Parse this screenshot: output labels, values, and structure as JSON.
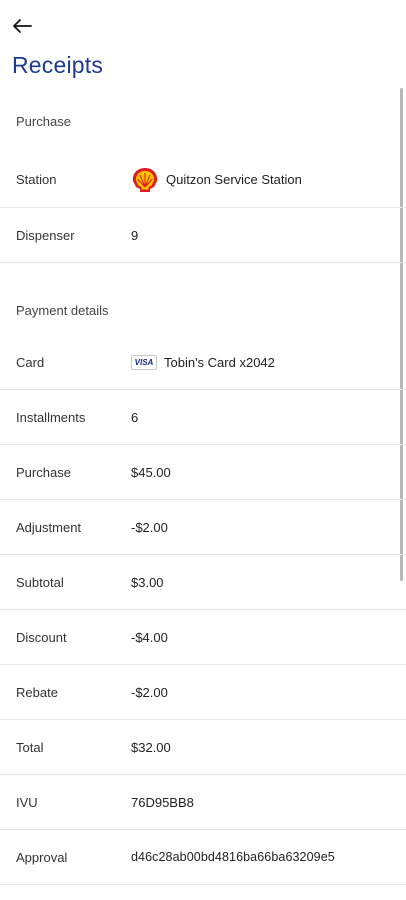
{
  "header": {
    "title": "Receipts",
    "back_icon": "arrow-left-icon"
  },
  "purchase_section": {
    "title": "Purchase",
    "station": {
      "label": "Station",
      "value": "Quitzon Service Station",
      "icon": "shell-logo-icon"
    },
    "dispenser": {
      "label": "Dispenser",
      "value": "9"
    }
  },
  "payment_section": {
    "title": "Payment details",
    "card": {
      "label": "Card",
      "value": "Tobin's Card x2042",
      "brand": "VISA"
    },
    "rows": [
      {
        "label": "Installments",
        "value": "6"
      },
      {
        "label": "Purchase",
        "value": "$45.00"
      },
      {
        "label": "Adjustment",
        "value": "-$2.00"
      },
      {
        "label": "Subtotal",
        "value": "$3.00"
      },
      {
        "label": "Discount",
        "value": "-$4.00"
      },
      {
        "label": "Rebate",
        "value": "-$2.00"
      },
      {
        "label": "Total",
        "value": "$32.00"
      },
      {
        "label": "IVU",
        "value": "76D95BB8"
      },
      {
        "label": "Approval",
        "value": "d46c28ab00bd4816ba66ba63209e5"
      }
    ]
  },
  "colors": {
    "title": "#1f3b8f",
    "divider": "#e6e6e6",
    "shell_red": "#dd1d21",
    "shell_yellow": "#ffc600"
  }
}
